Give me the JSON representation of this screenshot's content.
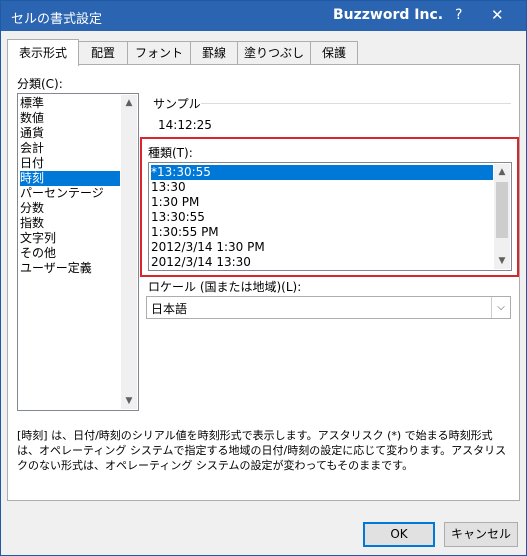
{
  "window": {
    "title": "セルの書式設定",
    "app_name": "Buzzword Inc.",
    "help": "?",
    "close": "✕"
  },
  "tabs": [
    {
      "label": "表示形式",
      "active": true
    },
    {
      "label": "配置"
    },
    {
      "label": "フォント"
    },
    {
      "label": "罫線"
    },
    {
      "label": "塗りつぶし"
    },
    {
      "label": "保護"
    }
  ],
  "category": {
    "label": "分類(C):",
    "items": [
      "標準",
      "数値",
      "通貨",
      "会計",
      "日付",
      "時刻",
      "パーセンテージ",
      "分数",
      "指数",
      "文字列",
      "その他",
      "ユーザー定義"
    ],
    "selected": "時刻"
  },
  "sample": {
    "label": "サンプル",
    "value": "14:12:25"
  },
  "type": {
    "label": "種類(T):",
    "items": [
      "*13:30:55",
      "13:30",
      "1:30 PM",
      "13:30:55",
      "1:30:55 PM",
      "2012/3/14 1:30 PM",
      "2012/3/14 13:30"
    ],
    "selected": "*13:30:55"
  },
  "locale": {
    "label": "ロケール (国または地域)(L):",
    "value": "日本語"
  },
  "description": "[時刻] は、日付/時刻のシリアル値を時刻形式で表示します。アスタリスク (*) で始まる時刻形式は、オペレーティング システムで指定する地域の日付/時刻の設定に応じて変わります。アスタリスクのない形式は、オペレーティング システムの設定が変わってもそのままです。",
  "buttons": {
    "ok": "OK",
    "cancel": "キャンセル"
  },
  "icons": {
    "scroll_up": "▲",
    "scroll_down": "▼",
    "dropdown": "⌵"
  },
  "colors": {
    "titlebar": "#2b64b0",
    "selection": "#0078d7",
    "highlight_box": "#d9262c"
  }
}
